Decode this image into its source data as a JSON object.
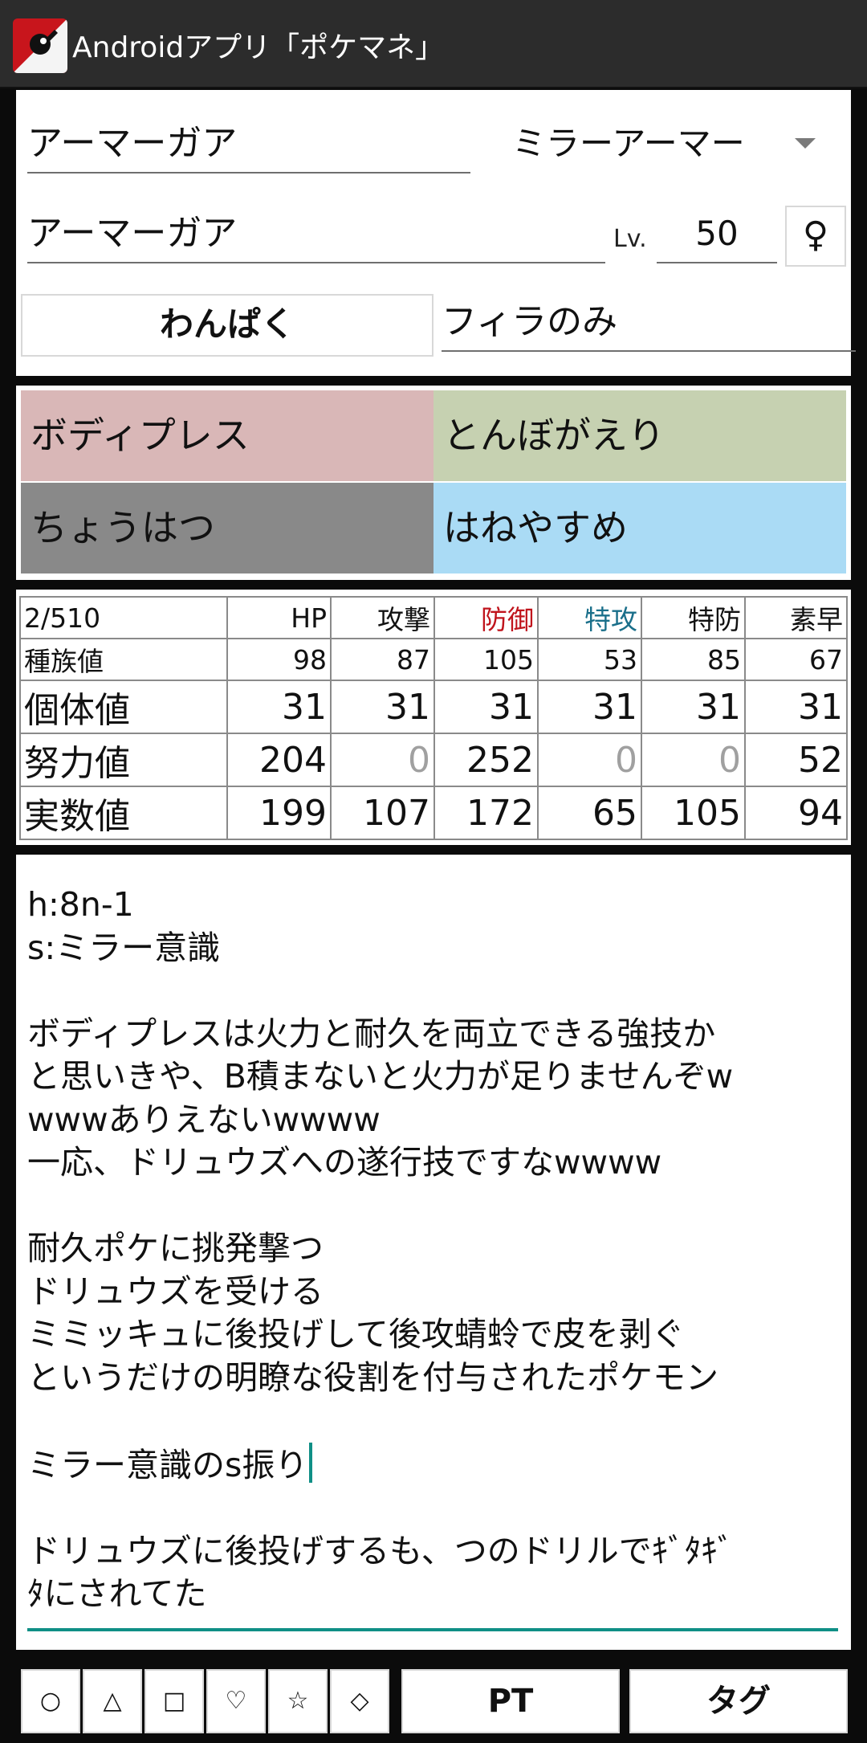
{
  "app": {
    "title": "Androidアプリ「ポケマネ」"
  },
  "header": {
    "species": "アーマーガア",
    "ability": "ミラーアーマー",
    "nickname": "アーマーガア",
    "level_label": "Lv.",
    "level": "50",
    "gender": "♀",
    "nature": "わんぱく",
    "item": "フィラのみ"
  },
  "moves": [
    {
      "name": "ボディプレス",
      "color": "#d9b7b7"
    },
    {
      "name": "とんぼがえり",
      "color": "#c6d1b1"
    },
    {
      "name": "ちょうはつ",
      "color": "#898989"
    },
    {
      "name": "はねやすめ",
      "color": "#aadbf5"
    }
  ],
  "stats": {
    "ev_total": "2/510",
    "columns": [
      {
        "label": "HP",
        "color": "#111111"
      },
      {
        "label": "攻撃",
        "color": "#111111"
      },
      {
        "label": "防御",
        "color": "#c0141c"
      },
      {
        "label": "特攻",
        "color": "#1a6f8a"
      },
      {
        "label": "特防",
        "color": "#111111"
      },
      {
        "label": "素早",
        "color": "#111111"
      }
    ],
    "rows": [
      {
        "label": "種族値",
        "values": [
          "98",
          "87",
          "105",
          "53",
          "85",
          "67"
        ]
      },
      {
        "label": "個体値",
        "values": [
          "31",
          "31",
          "31",
          "31",
          "31",
          "31"
        ]
      },
      {
        "label": "努力値",
        "values": [
          "204",
          "0",
          "252",
          "0",
          "0",
          "52"
        ]
      },
      {
        "label": "実数値",
        "values": [
          "199",
          "107",
          "172",
          "65",
          "105",
          "94"
        ]
      }
    ]
  },
  "memo": {
    "before_cursor": "h:8n-1\ns:ミラー意識\n\nボディプレスは火力と耐久を両立できる強技か\nと思いきや、B積まないと火力が足りませんぞw\nwwwありえないwwww\n一応、ドリュウズへの遂行技ですなwwww\n\n耐久ポケに挑発撃つ\nドリュウズを受ける\nミミッキュに後投げして後攻蜻蛉で皮を剥ぐ\nというだけの明瞭な役割を付与されたポケモン\n\nミラー意識のs振り",
    "after_cursor": "\n\nドリュウズに後投げするも、つのドリルでｷﾞﾀｷﾞ\nﾀにされてた"
  },
  "bottom_bar": {
    "symbols": [
      "○",
      "△",
      "□",
      "♡",
      "☆",
      "◇"
    ],
    "pt_label": "PT",
    "tag_label": "タグ"
  }
}
